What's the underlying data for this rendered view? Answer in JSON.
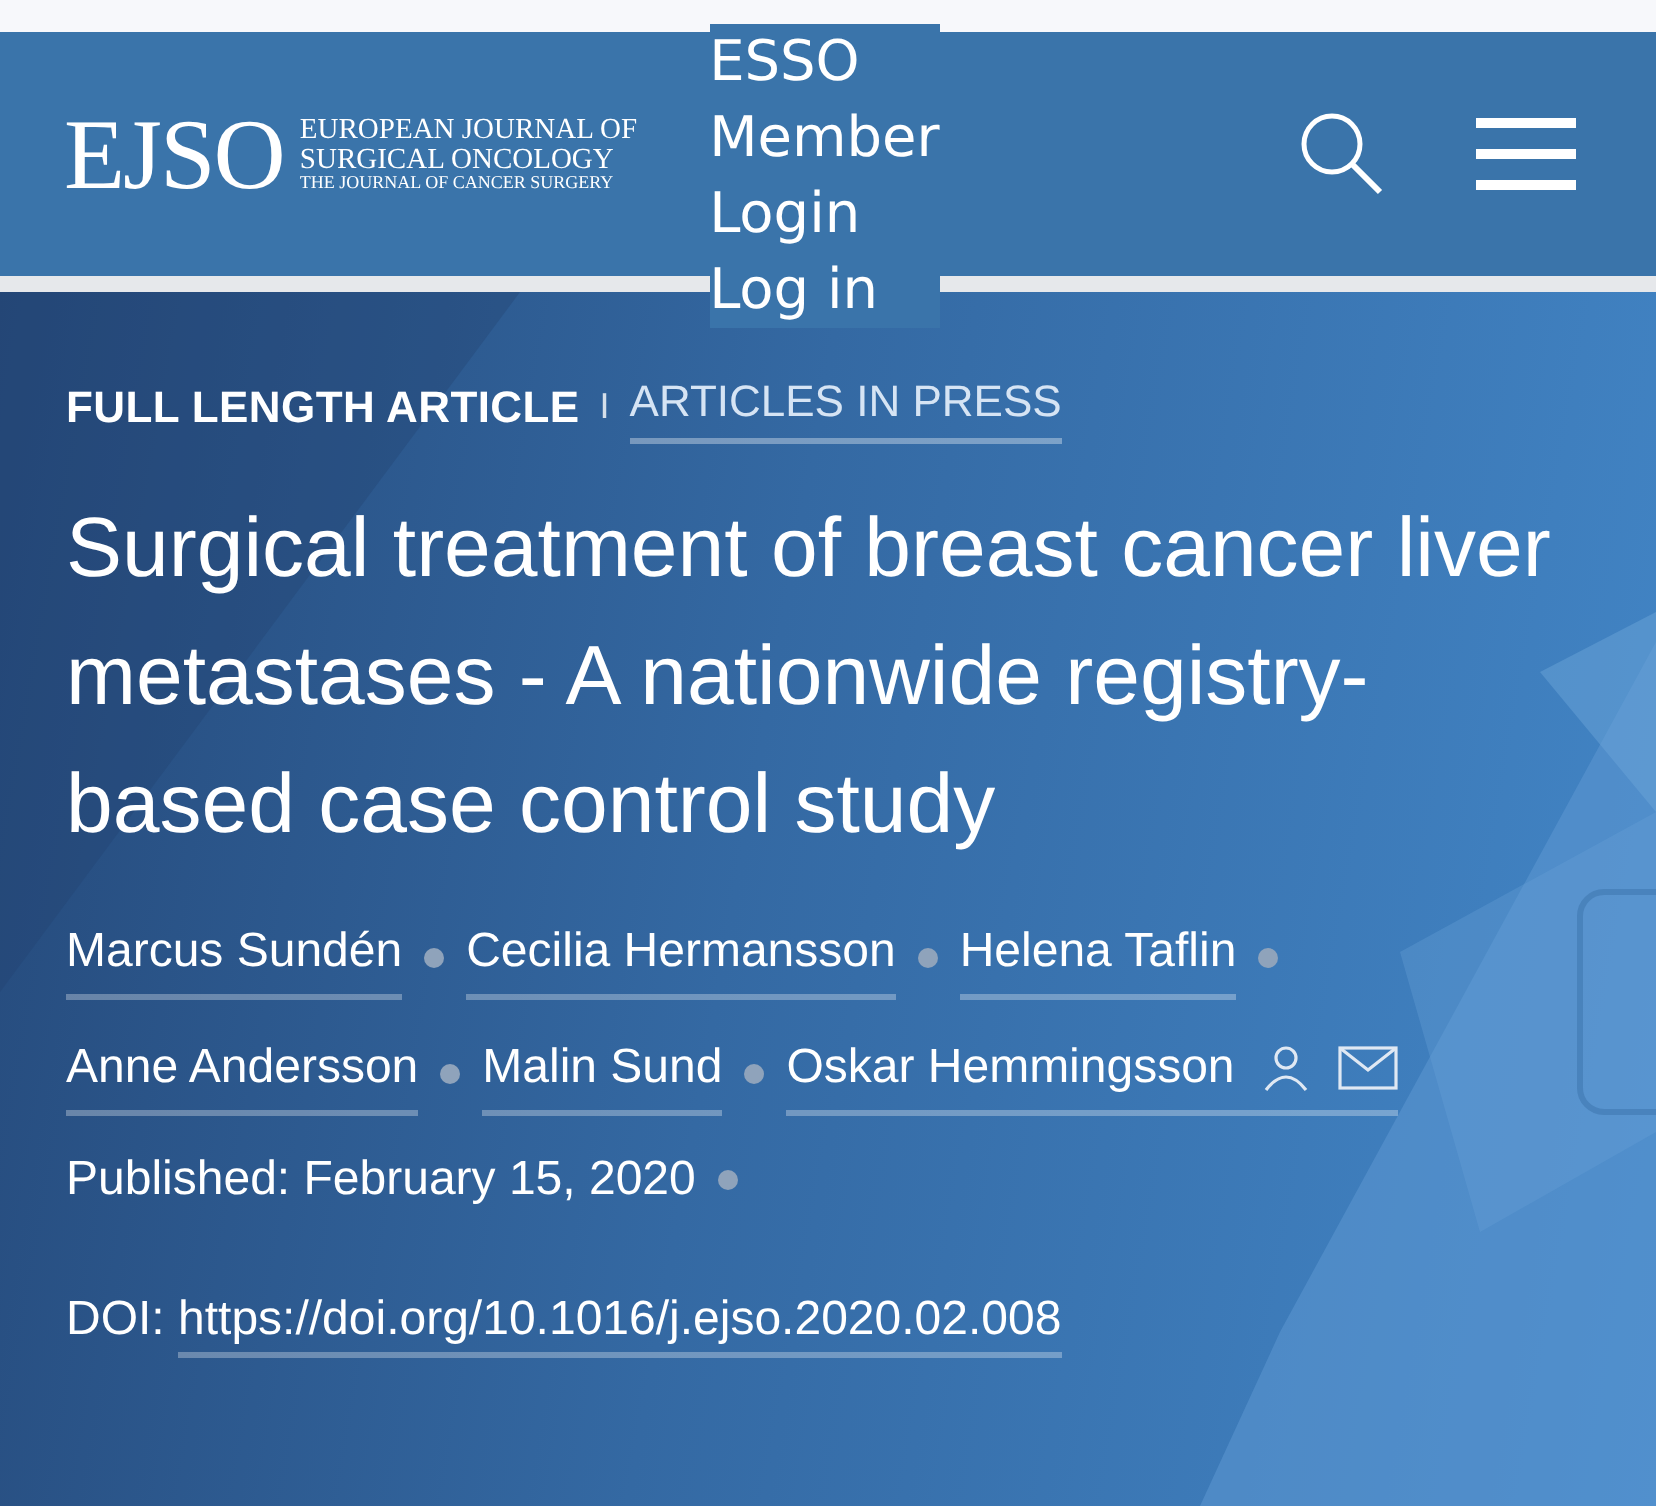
{
  "header": {
    "logo": {
      "mark": "EJSO",
      "lines": [
        "EUROPEAN JOURNAL OF",
        "SURGICAL ONCOLOGY",
        "THE JOURNAL OF CANCER SURGERY"
      ]
    },
    "member_link": {
      "lines": [
        "ESSO",
        "Member",
        "Login",
        "Log in"
      ]
    }
  },
  "article": {
    "type_label": "FULL LENGTH ARTICLE",
    "separator": "I",
    "section_link": "ARTICLES IN PRESS",
    "title": "Surgical treatment of breast cancer liver metastases - A nationwide registry-based case control study",
    "authors": [
      {
        "name": "Marcus Sundén",
        "contact": false
      },
      {
        "name": "Cecilia Hermansson",
        "contact": false
      },
      {
        "name": "Helena Taflin",
        "contact": false
      },
      {
        "name": "Anne Andersson",
        "contact": false
      },
      {
        "name": "Malin Sund",
        "contact": false
      },
      {
        "name": "Oskar Hemmingsson",
        "contact": true
      }
    ],
    "published": "Published: February 15, 2020",
    "doi_label": "DOI:",
    "doi": "https://doi.org/10.1016/j.ejso.2020.02.008"
  }
}
